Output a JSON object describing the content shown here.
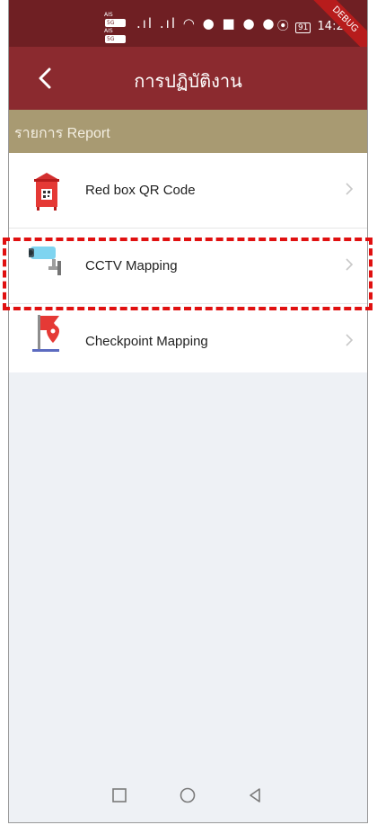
{
  "status_bar": {
    "carrier1": "AIS",
    "carrier2": "AIS",
    "carrier_tag": "5G",
    "battery": "91",
    "time": "14:23",
    "debug_banner": "DEBUG"
  },
  "app_bar": {
    "title": "การปฏิบัติงาน"
  },
  "section": {
    "label": "รายการ Report"
  },
  "items": [
    {
      "label": "Red box QR Code",
      "icon": "red-box-qr-icon"
    },
    {
      "label": "CCTV Mapping",
      "icon": "cctv-camera-icon"
    },
    {
      "label": "Checkpoint Mapping",
      "icon": "checkpoint-flag-icon"
    }
  ],
  "colors": {
    "status_bar": "#6f1f23",
    "app_bar": "#8b2a2f",
    "section": "#a89a72",
    "highlight": "#e01010"
  }
}
